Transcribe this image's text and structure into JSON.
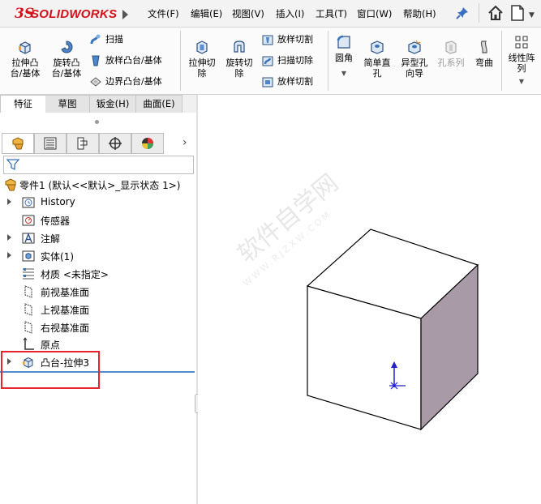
{
  "app": {
    "logo_prefix": "3S",
    "logo_text": "SOLIDWORKS"
  },
  "menu": [
    {
      "id": "file",
      "label": "文件(F)"
    },
    {
      "id": "edit",
      "label": "编辑(E)"
    },
    {
      "id": "view",
      "label": "视图(V)"
    },
    {
      "id": "insert",
      "label": "插入(I)"
    },
    {
      "id": "tools",
      "label": "工具(T)"
    },
    {
      "id": "window",
      "label": "窗口(W)"
    },
    {
      "id": "help",
      "label": "帮助(H)"
    }
  ],
  "ribbon": {
    "extrude_boss": "拉伸凸\n台/基体",
    "revolve_boss": "旋转凸\n台/基体",
    "sweep": "扫描",
    "loft_boss": "放样凸台/基体",
    "boundary_boss": "边界凸台/基体",
    "extrude_cut": "拉伸切\n除",
    "revolve_cut": "旋转切\n除",
    "loft_cut_1": "放样切割",
    "sweep_cut": "扫描切除",
    "loft_cut_2": "放样切割",
    "fillet": "圆角",
    "simple_hole": "简单直\n孔",
    "hole_wizard": "异型孔\n向导",
    "hole_series": "孔系列",
    "bend": "弯曲",
    "linear_pattern": "线性阵\n列"
  },
  "tabs": [
    {
      "id": "features",
      "label": "特征",
      "active": true
    },
    {
      "id": "sketch",
      "label": "草图",
      "active": false
    },
    {
      "id": "sheetmetal",
      "label": "钣金(H)",
      "active": false
    },
    {
      "id": "surface",
      "label": "曲面(E)",
      "active": false
    }
  ],
  "tree": {
    "part": "零件1 (默认<<默认>_显示状态 1>)",
    "history": "History",
    "sensors": "传感器",
    "annotations": "注解",
    "solid_bodies": "实体(1)",
    "material": "材质 <未指定>",
    "front_plane": "前视基准面",
    "top_plane": "上视基准面",
    "right_plane": "右视基准面",
    "origin": "原点",
    "boss_extrude": "凸台-拉伸3"
  },
  "watermark": {
    "text": "软件自学网",
    "url": "WWW.RJZXW.COM"
  },
  "colors": {
    "logo_red": "#d40f17",
    "highlight_red": "#e8232a",
    "cube_side": "#a89aa7",
    "selection_blue": "#4d8ccf"
  }
}
